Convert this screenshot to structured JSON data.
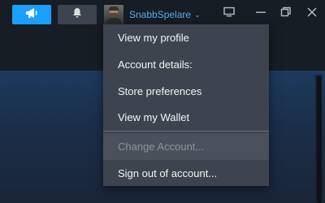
{
  "toolbar": {
    "announce_icon": "megaphone-icon",
    "notify_icon": "bell-icon",
    "accent_color": "#1a9fff"
  },
  "account": {
    "name": "SnabbSpelare",
    "chevron": "⌄"
  },
  "window_controls": {
    "big_picture_icon": "monitor-icon",
    "minimize_icon": "minimize-icon",
    "restore_icon": "restore-icon",
    "close_icon": "close-icon"
  },
  "account_menu": {
    "items": [
      {
        "label": "View my profile"
      },
      {
        "label": "Account details:"
      },
      {
        "label": "Store preferences"
      },
      {
        "label": "View my Wallet"
      },
      {
        "label": "Change Account..."
      },
      {
        "label": "Sign out of account..."
      }
    ]
  }
}
